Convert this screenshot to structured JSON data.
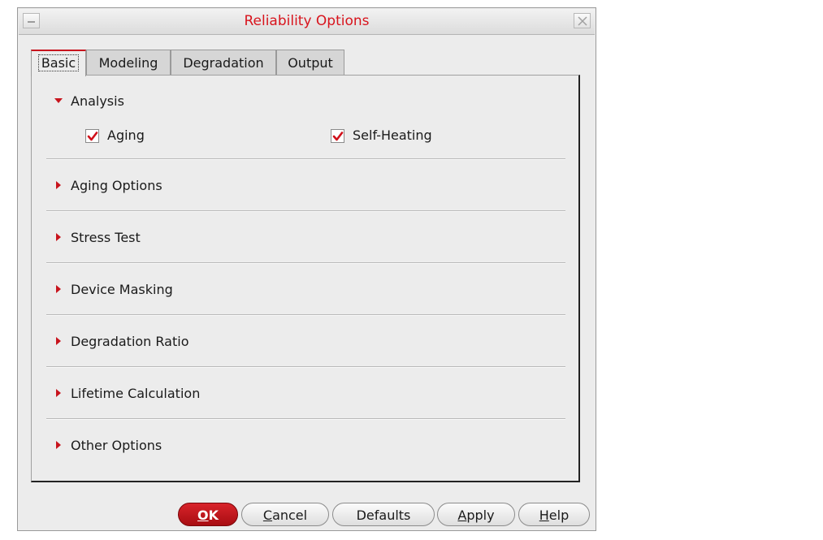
{
  "window": {
    "title": "Reliability Options",
    "title_color": "#d8141d"
  },
  "tabs": [
    {
      "label": "Basic",
      "active": true
    },
    {
      "label": "Modeling",
      "active": false
    },
    {
      "label": "Degradation",
      "active": false
    },
    {
      "label": "Output",
      "active": false
    }
  ],
  "sections": [
    {
      "label": "Analysis",
      "expanded": true
    },
    {
      "label": "Aging Options",
      "expanded": false
    },
    {
      "label": "Stress Test",
      "expanded": false
    },
    {
      "label": "Device Masking",
      "expanded": false
    },
    {
      "label": "Degradation Ratio",
      "expanded": false
    },
    {
      "label": "Lifetime Calculation",
      "expanded": false
    },
    {
      "label": "Other Options",
      "expanded": false
    }
  ],
  "analysis": {
    "aging": {
      "label": "Aging",
      "checked": true
    },
    "self_heating": {
      "label": "Self-Heating",
      "checked": true
    }
  },
  "buttons": {
    "ok": {
      "mnemonic": "O",
      "rest": "K"
    },
    "cancel": {
      "mnemonic": "C",
      "rest": "ancel"
    },
    "defaults": {
      "mnemonic": "",
      "rest": "Defaults"
    },
    "apply": {
      "mnemonic": "A",
      "rest": "pply"
    },
    "help": {
      "mnemonic": "H",
      "rest": "elp"
    }
  },
  "colors": {
    "accent": "#c8141d",
    "check": "#d0101a",
    "primary_button": "#c0161c"
  },
  "icons": {
    "expanded": "triangle-down-icon",
    "collapsed": "triangle-right-icon",
    "check": "checkmark-icon",
    "close": "close-icon",
    "window_menu": "window-menu-icon"
  }
}
